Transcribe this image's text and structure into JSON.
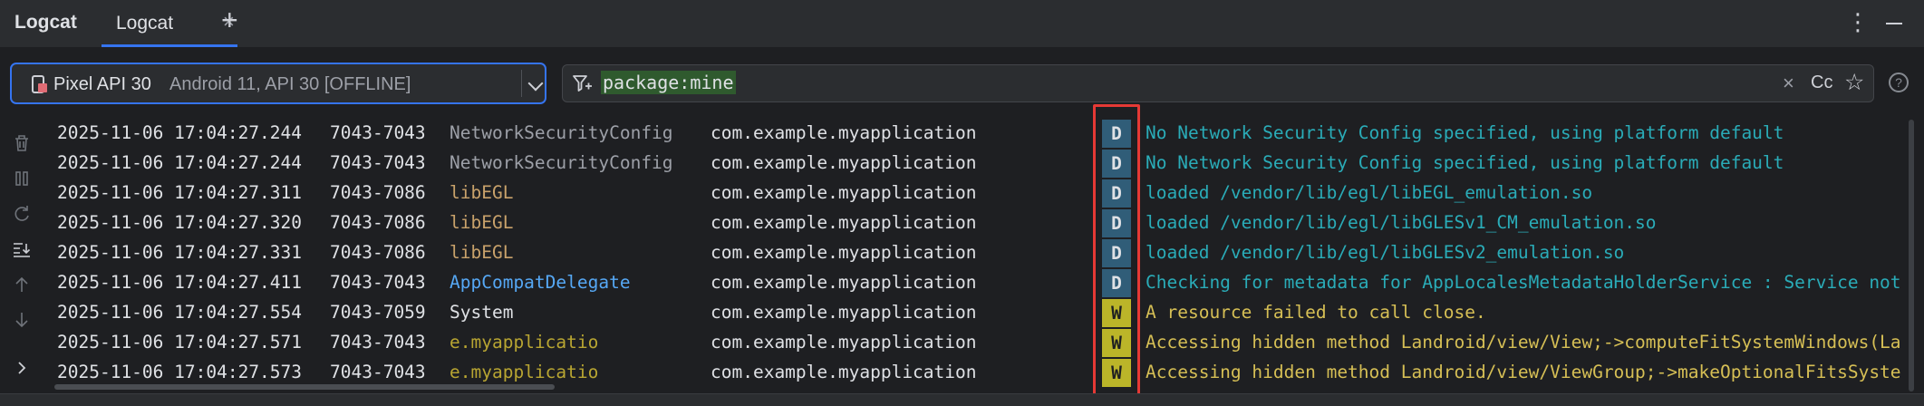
{
  "tool_window": {
    "title": "Logcat"
  },
  "tabs": [
    {
      "label": "Logcat",
      "close": "×"
    }
  ],
  "tab_add": "+",
  "more_options": "⋮",
  "device": {
    "name": "Pixel API 30",
    "detail": "Android 11, API 30 [OFFLINE]"
  },
  "filter": {
    "query": "package:mine",
    "clear": "×",
    "match_case": "Cc",
    "favorite": "☆"
  },
  "help": "?",
  "left_actions": [
    {
      "icon": "trash-icon"
    },
    {
      "icon": "pause-icon"
    },
    {
      "icon": "restart-icon"
    },
    {
      "icon": "scroll-to-end-icon"
    },
    {
      "icon": "arrow-up-icon"
    },
    {
      "icon": "arrow-down-icon"
    },
    {
      "icon": "chevron-right-icon"
    }
  ],
  "log": [
    {
      "timestamp": "2025-11-06 17:04:27.244",
      "pid_tid": "7043-7043",
      "tag": "NetworkSecurityConfig",
      "tag_color": "grey",
      "package": "com.example.myapplication",
      "level": "D",
      "message": "No Network Security Config specified, using platform default"
    },
    {
      "timestamp": "2025-11-06 17:04:27.244",
      "pid_tid": "7043-7043",
      "tag": "NetworkSecurityConfig",
      "tag_color": "grey",
      "package": "com.example.myapplication",
      "level": "D",
      "message": "No Network Security Config specified, using platform default"
    },
    {
      "timestamp": "2025-11-06 17:04:27.311",
      "pid_tid": "7043-7086",
      "tag": "libEGL",
      "tag_color": "orange",
      "package": "com.example.myapplication",
      "level": "D",
      "message": "loaded /vendor/lib/egl/libEGL_emulation.so"
    },
    {
      "timestamp": "2025-11-06 17:04:27.320",
      "pid_tid": "7043-7086",
      "tag": "libEGL",
      "tag_color": "orange",
      "package": "com.example.myapplication",
      "level": "D",
      "message": "loaded /vendor/lib/egl/libGLESv1_CM_emulation.so"
    },
    {
      "timestamp": "2025-11-06 17:04:27.331",
      "pid_tid": "7043-7086",
      "tag": "libEGL",
      "tag_color": "orange",
      "package": "com.example.myapplication",
      "level": "D",
      "message": "loaded /vendor/lib/egl/libGLESv2_emulation.so"
    },
    {
      "timestamp": "2025-11-06 17:04:27.411",
      "pid_tid": "7043-7043",
      "tag": "AppCompatDelegate",
      "tag_color": "blue",
      "package": "com.example.myapplication",
      "level": "D",
      "message": "Checking for metadata for AppLocalesMetadataHolderService : Service not"
    },
    {
      "timestamp": "2025-11-06 17:04:27.554",
      "pid_tid": "7043-7059",
      "tag": "System",
      "tag_color": "white",
      "package": "com.example.myapplication",
      "level": "W",
      "message": "A resource failed to call close."
    },
    {
      "timestamp": "2025-11-06 17:04:27.571",
      "pid_tid": "7043-7043",
      "tag": "e.myapplicatio",
      "tag_color": "yellow",
      "package": "com.example.myapplication",
      "level": "W",
      "message": "Accessing hidden method Landroid/view/View;->computeFitSystemWindows(La"
    },
    {
      "timestamp": "2025-11-06 17:04:27.573",
      "pid_tid": "7043-7043",
      "tag": "e.myapplicatio",
      "tag_color": "yellow",
      "package": "com.example.myapplication",
      "level": "W",
      "message": "Accessing hidden method Landroid/view/ViewGroup;->makeOptionalFitsSyste"
    }
  ],
  "colors": {
    "accent": "#3574f0",
    "level_debug_bg": "#305d78",
    "level_warn_bg": "#bbb529",
    "debug_text": "#2aacb8",
    "warn_text": "#d6bf55",
    "highlight_box": "#e53935"
  }
}
